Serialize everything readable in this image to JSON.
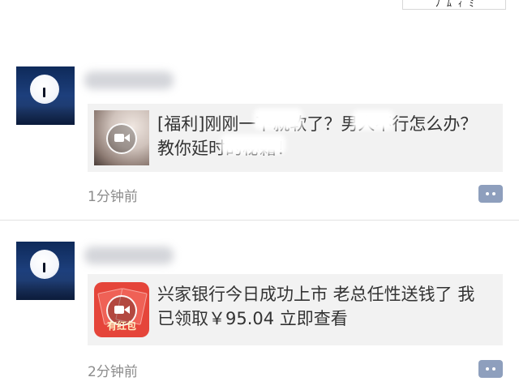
{
  "posts": [
    {
      "card_title": "[福利]刚刚一下就软了？男人不行怎么办？教你延时的秘籍！",
      "timestamp": "1分钟前",
      "thumbnail_icon": "video-icon"
    },
    {
      "card_title": "兴家银行今日成功上市 老总任性送钱了 我已领取￥95.04 立即查看",
      "thumbnail_label": "有红包",
      "timestamp": "2分钟前",
      "thumbnail_icon": "video-icon"
    }
  ],
  "colors": {
    "card_bg": "#f2f2f2",
    "comment_button": "#8e9fbd",
    "timestamp": "#8c8c8c",
    "red_packet": "#e5453a"
  }
}
